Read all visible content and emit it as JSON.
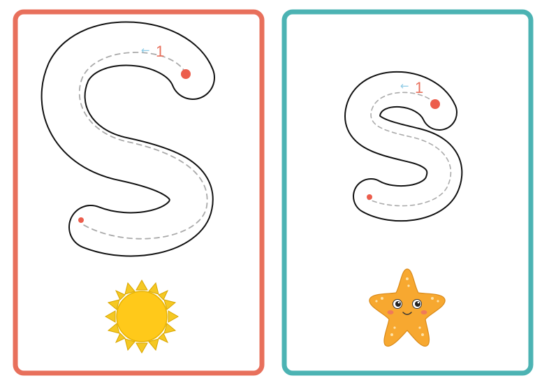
{
  "cards": [
    {
      "letter": "S",
      "case": "uppercase",
      "stroke_number": "1",
      "arrow": "←",
      "picture": "sun",
      "frame_color": "#e8705c"
    },
    {
      "letter": "s",
      "case": "lowercase",
      "stroke_number": "1",
      "arrow": "←",
      "picture": "starfish",
      "frame_color": "#4cb3b3"
    }
  ],
  "colors": {
    "start_dot": "#ec5d4c",
    "guide_dash": "#aaaaaa",
    "letter_outline": "#111111",
    "number_red": "#e8705c",
    "arrow_blue": "#8ecbe6",
    "sun_fill": "#ffc91a",
    "sun_rays": "#f5c823",
    "starfish_fill": "#f7a830"
  }
}
